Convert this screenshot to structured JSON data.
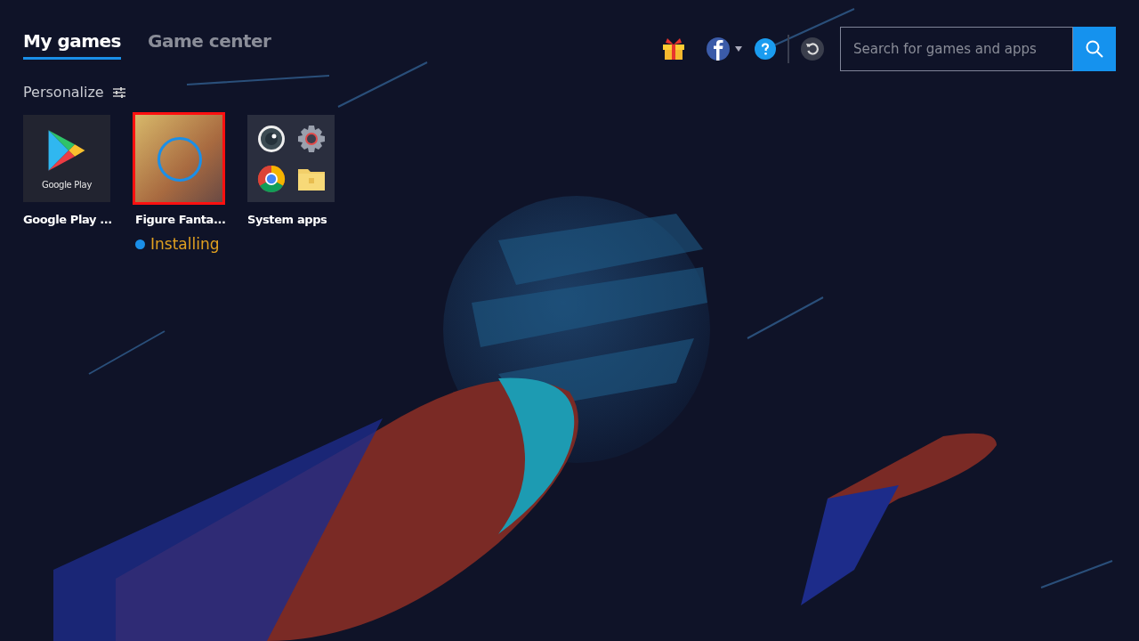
{
  "tabs": [
    {
      "label": "My games",
      "selected": true
    },
    {
      "label": "Game center",
      "selected": false
    }
  ],
  "toolbar": {
    "search": {
      "placeholder": "Search for games and apps"
    }
  },
  "section": {
    "title": "Personalize"
  },
  "apps": [
    {
      "kind": "store",
      "name": "Google Play ...",
      "icon_label": "Google Play",
      "selected": false
    },
    {
      "kind": "game",
      "name": "Figure Fanta...",
      "selected": true,
      "loading": true,
      "status": "Installing"
    },
    {
      "kind": "folder",
      "name": "System apps",
      "selected": false
    }
  ]
}
